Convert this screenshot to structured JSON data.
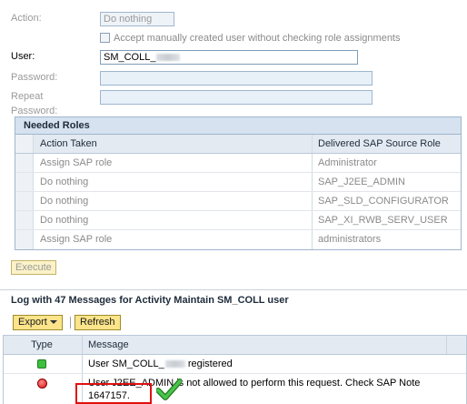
{
  "form": {
    "action_label": "Action:",
    "action_value": "Do nothing",
    "accept_checkbox_label": "Accept manually created user without checking role assignments",
    "user_label": "User:",
    "user_value": "SM_COLL_",
    "password_label": "Password:",
    "password_value": "",
    "repeat_password_label": "Repeat Password:",
    "repeat_password_value": ""
  },
  "roles": {
    "title": "Needed Roles",
    "columns": [
      "Action Taken",
      "Delivered SAP Source Role"
    ],
    "rows": [
      [
        "Assign SAP role",
        "Administrator"
      ],
      [
        "Do nothing",
        "SAP_J2EE_ADMIN"
      ],
      [
        "Do nothing",
        "SAP_SLD_CONFIGURATOR"
      ],
      [
        "Do nothing",
        "SAP_XI_RWB_SERV_USER"
      ],
      [
        "Assign SAP role",
        "administrators"
      ]
    ]
  },
  "execute_label": "Execute",
  "log": {
    "title": "Log with 47 Messages for Activity Maintain SM_COLL user",
    "export_label": "Export",
    "refresh_label": "Refresh",
    "columns": [
      "Type",
      "Message"
    ],
    "rows": [
      {
        "type": "success",
        "message_prefix": "User SM_COLL_",
        "message_suffix": " registered"
      },
      {
        "type": "error",
        "message": "User J2EE_ADMIN is not allowed to perform this request. Check SAP Note 1647157."
      }
    ]
  },
  "colors": {
    "highlight_box": "#e01010",
    "success": "#3fbf3f",
    "error": "#d41414",
    "checkmark": "#2fa52f"
  }
}
